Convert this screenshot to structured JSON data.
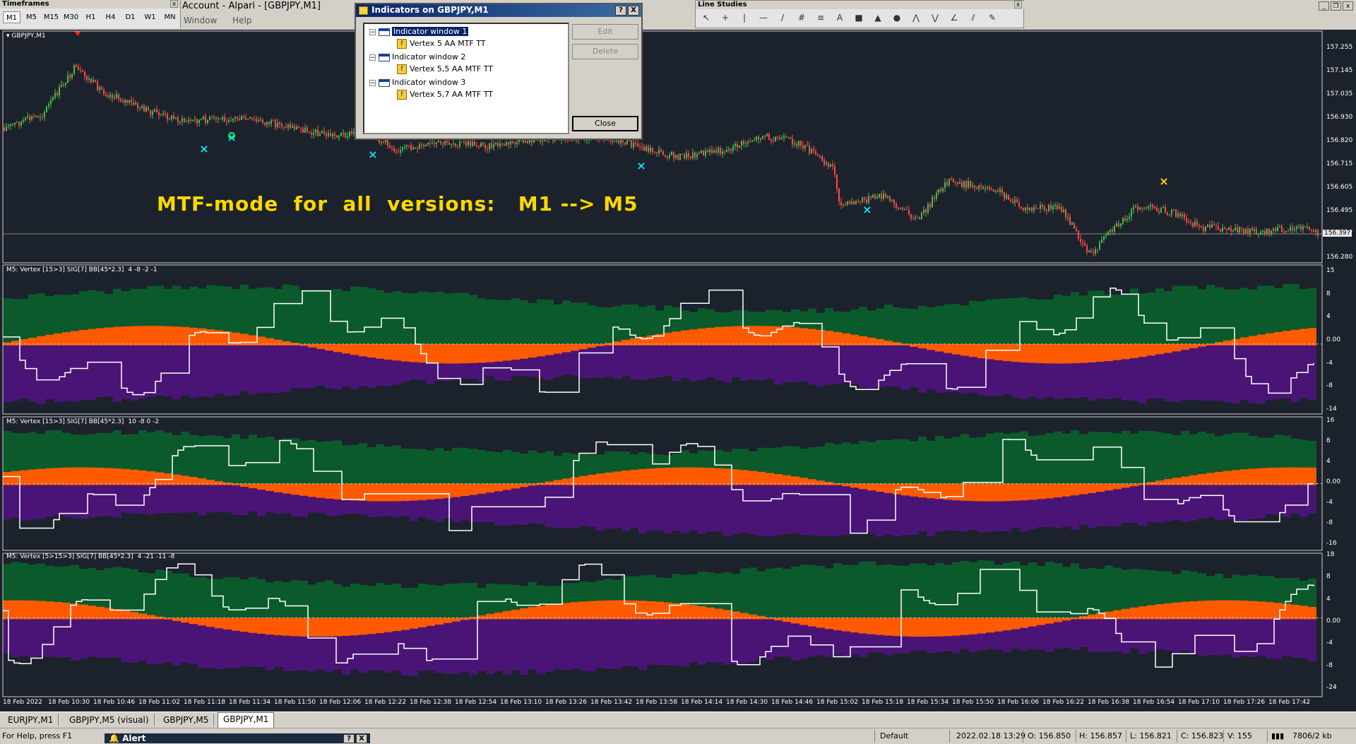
{
  "timeframes_panel": {
    "title": "Timeframes",
    "buttons": [
      "M1",
      "M5",
      "M15",
      "M30",
      "H1",
      "H4",
      "D1",
      "W1",
      "MN"
    ],
    "active": "M1"
  },
  "app": {
    "title": "Account - Alpari - [GBPJPY,M1]",
    "menu": [
      "Window",
      "Help"
    ]
  },
  "line_studies_panel": {
    "title": "Line Studies",
    "tools": [
      "cursor-icon",
      "crosshair-icon",
      "vertical-line-icon",
      "horizontal-line-icon",
      "trendline-icon",
      "fibonacci-icon",
      "channel-icon",
      "text-icon",
      "rectangle-icon",
      "triangle-icon",
      "ellipse-icon",
      "pitchfork-icon",
      "fan-icon",
      "angle-icon",
      "fib-time-icon",
      "arrow-dropdown-icon"
    ],
    "tool_glyphs": [
      "↖",
      "+",
      "|",
      "—",
      "/",
      "#",
      "≡",
      "A",
      "■",
      "▲",
      "●",
      "⋀",
      "⋁",
      "∠",
      "⫽",
      "✎"
    ]
  },
  "dialog": {
    "title": "Indicators on GBPJPY,M1",
    "help_btn": "?",
    "close_btn": "X",
    "tree": [
      {
        "window": "Indicator window 1",
        "indicator": "Vertex 5 AA MTF TT",
        "selected": true
      },
      {
        "window": "Indicator window 2",
        "indicator": "Vertex 5,5 AA MTF TT",
        "selected": false
      },
      {
        "window": "Indicator window 3",
        "indicator": "Vertex 5,7 AA MTF TT",
        "selected": false
      }
    ],
    "expander": "−",
    "edit_label": "Edit",
    "delete_label": "Delete",
    "close_label": "Close"
  },
  "main_chart": {
    "symbol_label": "GBPJPY,M1",
    "watermark": "MTF-mode  for  all  versions:   M1 --> M5",
    "price_ticks": [
      "157.255",
      "157.145",
      "157.035",
      "156.930",
      "156.820",
      "156.715",
      "156.605",
      "156.495",
      "156.397",
      "156.280"
    ],
    "current_price": "156.397"
  },
  "panes": [
    {
      "label": "M5: Vertex [15>3] SIG[7] BB[45*2.3]",
      "values": "4 -8 -2 -1",
      "ticks": [
        "15",
        "8",
        "4",
        "0.00",
        "-4",
        "-8",
        "-14"
      ]
    },
    {
      "label": "M5: Vertex [15>3] SIG[7] BB[45*2.3]",
      "values": "10 -8 0 -2",
      "ticks": [
        "16",
        "8",
        "4",
        "0.00",
        "-4",
        "-8",
        "-16"
      ]
    },
    {
      "label": "M5: Vertex [5>15>3] SIG[7] BB[45*2.3]",
      "values": "4 -21 -11 -8",
      "ticks": [
        "18",
        "8",
        "4",
        "0.00",
        "-4",
        "-8",
        "-24"
      ]
    }
  ],
  "time_axis": [
    "18 Feb 2022",
    "18 Feb 10:30",
    "18 Feb 10:46",
    "18 Feb 11:02",
    "18 Feb 11:18",
    "18 Feb 11:34",
    "18 Feb 11:50",
    "18 Feb 12:06",
    "18 Feb 12:22",
    "18 Feb 12:38",
    "18 Feb 12:54",
    "18 Feb 13:10",
    "18 Feb 13:26",
    "18 Feb 13:42",
    "18 Feb 13:58",
    "18 Feb 14:14",
    "18 Feb 14:30",
    "18 Feb 14:46",
    "18 Feb 15:02",
    "18 Feb 15:18",
    "18 Feb 15:34",
    "18 Feb 15:50",
    "18 Feb 16:06",
    "18 Feb 16:22",
    "18 Feb 16:38",
    "18 Feb 16:54",
    "18 Feb 17:10",
    "18 Feb 17:26",
    "18 Feb 17:42"
  ],
  "tabs": [
    "EURJPY,M1",
    "GBPJPY,M5 (visual)",
    "GBPJPY,M5",
    "GBPJPY,M1"
  ],
  "active_tab": "GBPJPY,M1",
  "status": {
    "help": "For Help, press F1",
    "profile": "Default",
    "datetime": "2022.02.18 13:29",
    "open": "O: 156.850",
    "high": "H: 156.857",
    "low": "L: 156.821",
    "close": "C: 156.823",
    "volume": "V: 155",
    "traffic": "7806/2 kb"
  },
  "alert": {
    "title": "Alert",
    "help_btn": "?",
    "close_btn": "X"
  },
  "colors": {
    "background": "#1c222b",
    "green_band": "#0b5a2c",
    "orange_band": "#ff5a00",
    "purple_band": "#4a1477",
    "signal_line": "#ffffff",
    "watermark": "#ffd700",
    "markers_cyan": "#00e5ff",
    "markers_yellow": "#ffd700"
  }
}
